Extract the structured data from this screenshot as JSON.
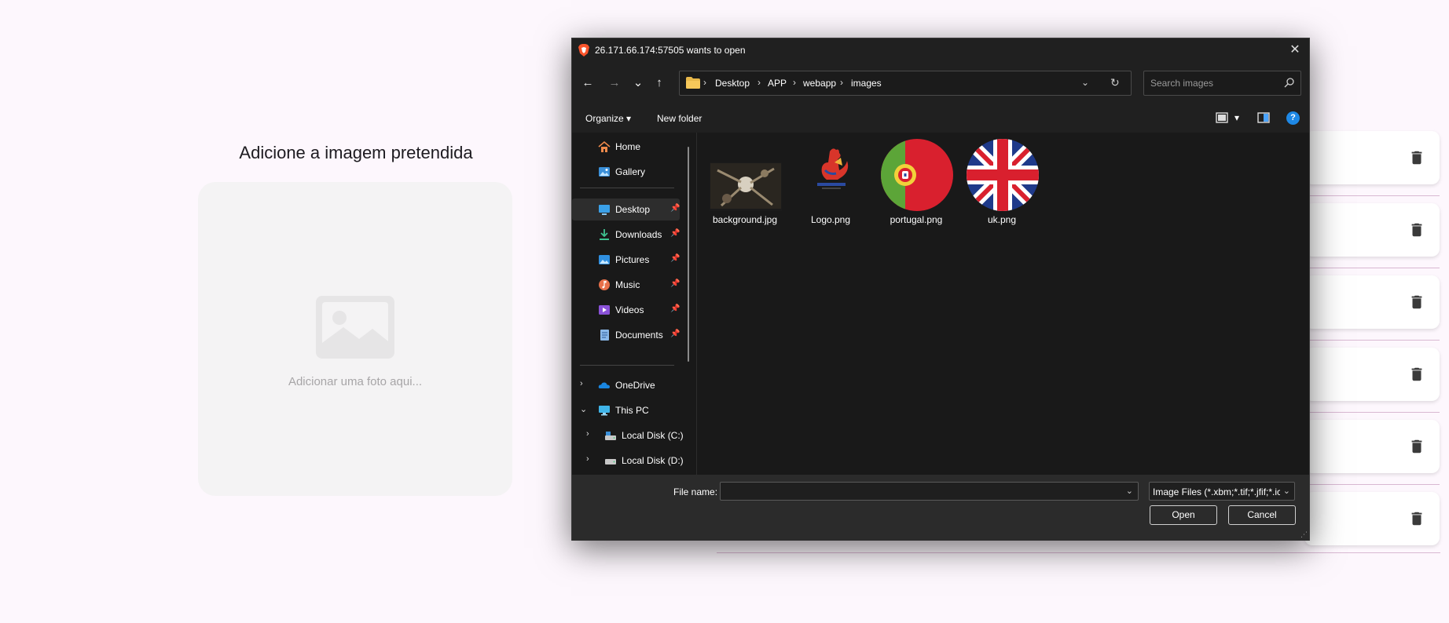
{
  "page": {
    "heading": "Adicione a imagem pretendida",
    "upload_placeholder": "Adicionar uma foto aqui...",
    "list_item_count": 6
  },
  "dialog": {
    "title": "26.171.66.174:57505 wants to open",
    "close_glyph": "✕",
    "nav": {
      "back_glyph": "←",
      "forward_glyph": "→",
      "recent_glyph": "⌄",
      "up_glyph": "↑"
    },
    "breadcrumb": [
      "Desktop",
      "APP",
      "webapp",
      "images"
    ],
    "breadcrumb_sep": "›",
    "address_dropdown_glyph": "⌄",
    "refresh_glyph": "↻",
    "search_placeholder": "Search images",
    "toolbar": {
      "organize": "Organize ▾",
      "new_folder": "New folder",
      "view_dropdown_glyph": "▾",
      "help_glyph": "?"
    },
    "nav_pane": {
      "quick": [
        {
          "label": "Home",
          "icon": "home-icon"
        },
        {
          "label": "Gallery",
          "icon": "gallery-icon"
        }
      ],
      "pinned": [
        {
          "label": "Desktop",
          "icon": "desktop-icon",
          "selected": true
        },
        {
          "label": "Downloads",
          "icon": "downloads-icon"
        },
        {
          "label": "Pictures",
          "icon": "pictures-icon"
        },
        {
          "label": "Music",
          "icon": "music-icon"
        },
        {
          "label": "Videos",
          "icon": "videos-icon"
        },
        {
          "label": "Documents",
          "icon": "documents-icon"
        }
      ],
      "pin_glyph": "📌",
      "tree": [
        {
          "label": "OneDrive",
          "icon": "onedrive-icon",
          "expander": "›"
        },
        {
          "label": "This PC",
          "icon": "this-pc-icon",
          "expander": "⌄"
        },
        {
          "label": "Local Disk (C:)",
          "icon": "drive-c-icon",
          "expander": "›"
        },
        {
          "label": "Local Disk (D:)",
          "icon": "drive-d-icon",
          "expander": "›"
        }
      ]
    },
    "files": [
      {
        "name": "background.jpg",
        "icon": "background-thumbnail"
      },
      {
        "name": "Logo.png",
        "icon": "logo-thumbnail"
      },
      {
        "name": "portugal.png",
        "icon": "portugal-flag-thumbnail"
      },
      {
        "name": "uk.png",
        "icon": "uk-flag-thumbnail"
      }
    ],
    "footer": {
      "file_name_label": "File name:",
      "file_name_value": "",
      "filter_value": "Image Files (*.xbm;*.tif;*.jfif;*.ic",
      "dropdown_glyph": "⌄",
      "open": "Open",
      "cancel": "Cancel",
      "grip_glyph": "⋰"
    }
  }
}
